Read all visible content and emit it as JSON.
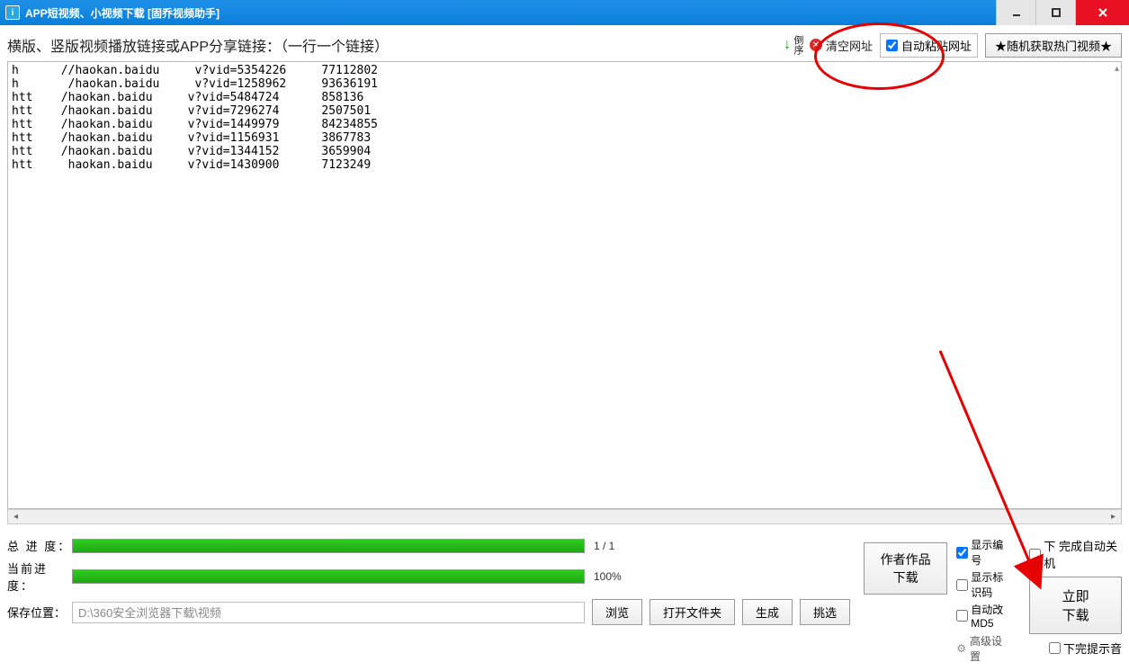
{
  "window": {
    "title": "APP短视频、小视频下载 [固乔视频助手]"
  },
  "topbar": {
    "label": "横版、竖版视频播放链接或APP分享链接：（一行一个链接）",
    "sort": "倒序",
    "clear": "清空网址",
    "auto_paste": "自动粘贴网址",
    "random_hot": "★随机获取热门视频★"
  },
  "urls": [
    "h      //haokan.baidu     v?vid=5354226     77112802",
    "h       /haokan.baidu     v?vid=1258962     93636191",
    "htt    /haokan.baidu     v?vid=5484724      858136",
    "htt    /haokan.baidu     v?vid=7296274      2507501",
    "htt    /haokan.baidu     v?vid=1449979      84234855",
    "htt    /haokan.baidu     v?vid=1156931      3867783",
    "htt    /haokan.baidu     v?vid=1344152      3659904",
    "htt     haokan.baidu     v?vid=1430900      7123249"
  ],
  "progress": {
    "total_label": "总 进 度：",
    "current_label": "当前进度：",
    "total_text": "1 / 1",
    "current_text": "100%",
    "total_pct": 100,
    "current_pct": 100
  },
  "save": {
    "label": "保存位置：",
    "path": "D:\\360安全浏览器下载\\视频",
    "browse": "浏览",
    "open_folder": "打开文件夹",
    "generate": "生成",
    "pick": "挑选"
  },
  "mid": {
    "author_works": "作者作品下载"
  },
  "options": {
    "show_number": "显示编号",
    "show_id": "显示标识码",
    "auto_md5": "自动改MD5",
    "advanced": "高级设置"
  },
  "right": {
    "auto_shutdown": "下   完成自动关机",
    "download_now": "立即下载",
    "done_sound": "下完提示音"
  }
}
